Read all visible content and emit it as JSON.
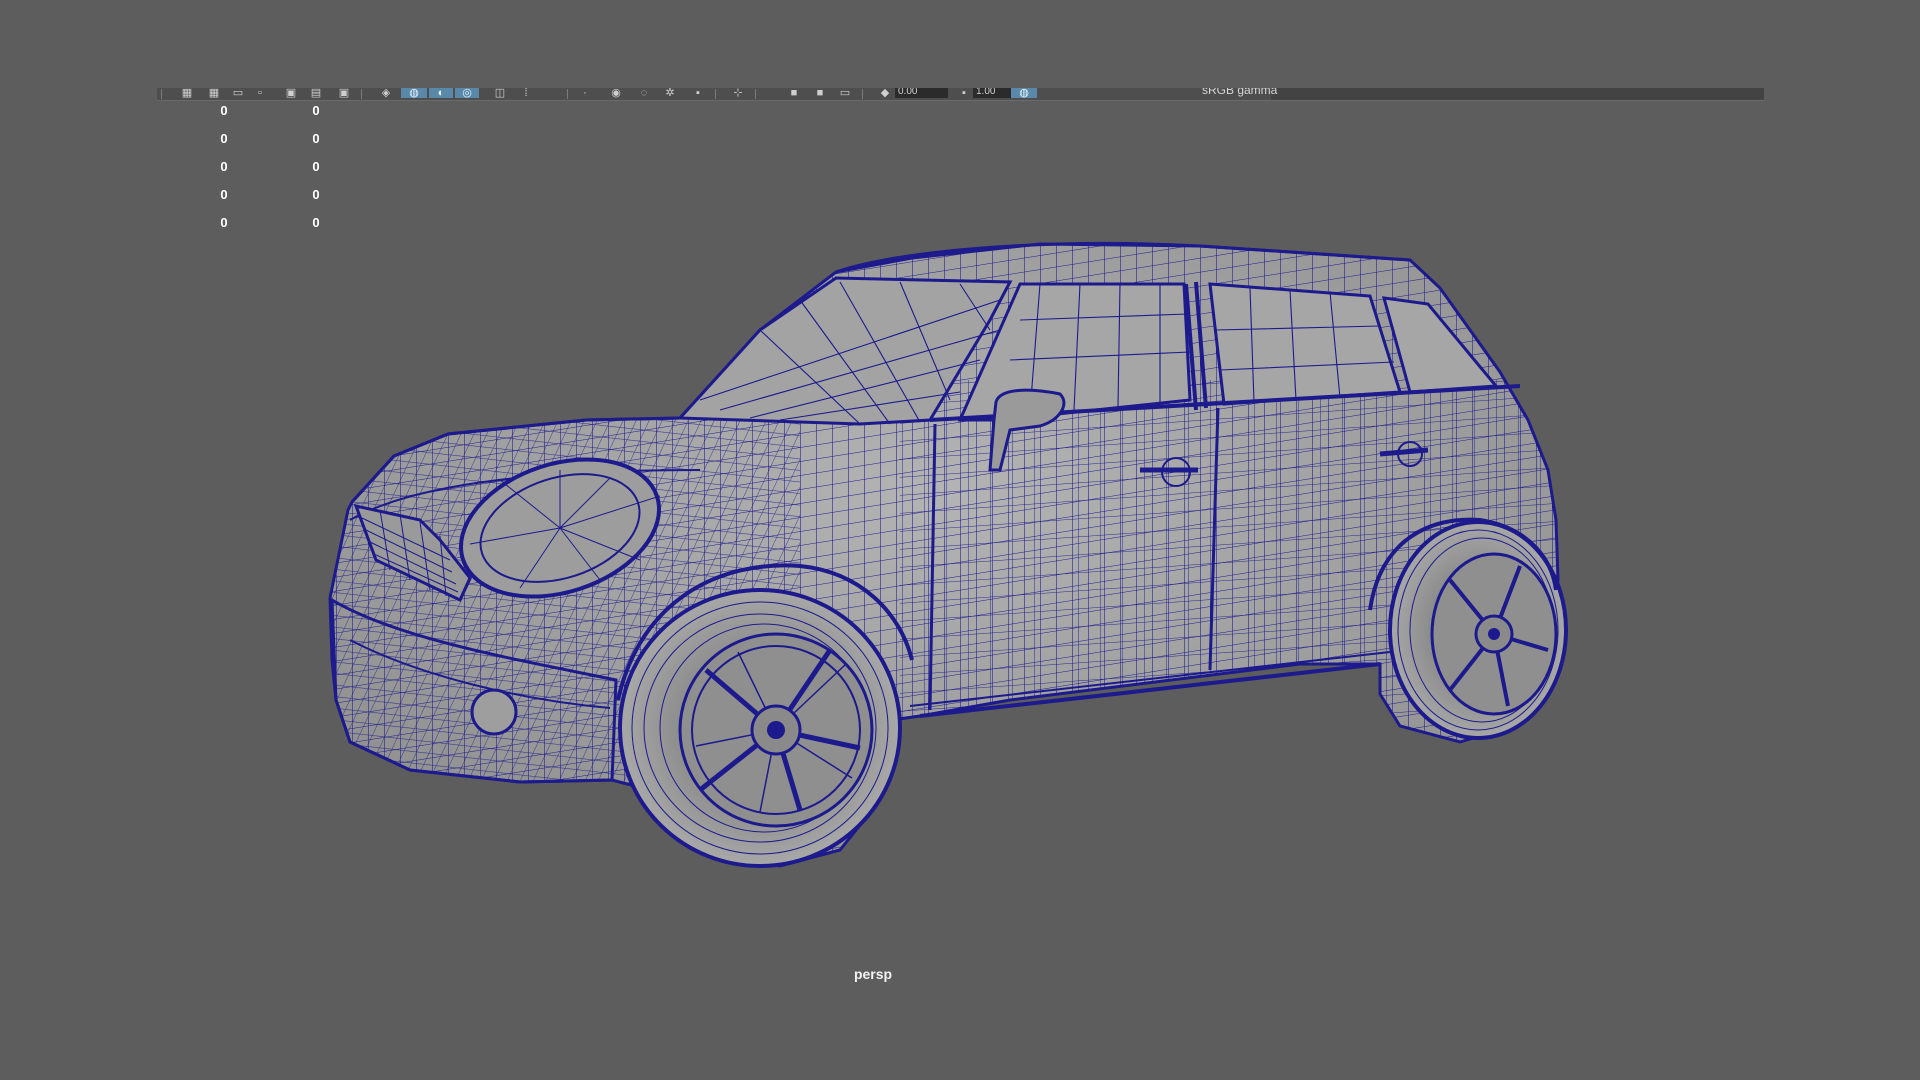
{
  "viewport": {
    "background": "#5d5d5d",
    "wireframe_color": "#1c1a8c",
    "shaded_color": "#9e9e9e",
    "camera_name": "persp",
    "model": "car (four-door hatchback) in wireframe-on-shaded mode"
  },
  "toolbar": {
    "icons": [
      {
        "icon": "select-camera-icon"
      },
      {
        "icon": "grid-icon"
      },
      {
        "icon": "film-gate-icon"
      },
      {
        "icon": "resolution-gate-icon"
      },
      {
        "icon": "gate-mask-icon"
      },
      {
        "icon": "field-chart-icon"
      },
      {
        "icon": "safe-action-icon"
      },
      {
        "icon": "safe-title-icon"
      },
      {
        "icon": "wireframe-icon"
      },
      {
        "icon": "smooth-shade-icon",
        "active": true
      },
      {
        "icon": "default-material-icon",
        "active": true
      },
      {
        "icon": "wireframe-on-shaded-icon",
        "active": true
      },
      {
        "icon": "textured-icon"
      },
      {
        "icon": "lights-icon"
      },
      {
        "icon": "shadows-icon"
      },
      {
        "icon": "ambient-occlusion-icon"
      },
      {
        "icon": "isolate-select-icon"
      },
      {
        "icon": "xray-icon"
      },
      {
        "icon": "xray-joints-icon"
      },
      {
        "icon": "xray-components-icon"
      },
      {
        "icon": "exposure-icon"
      },
      {
        "icon": "gamma-icon"
      },
      {
        "icon": "color-management-icon",
        "active": true
      }
    ],
    "exposure_value": "0.00",
    "gamma_value": "1.00",
    "view_transform_label": "sRGB gamma"
  },
  "hud": {
    "rows": [
      [
        "0",
        "0"
      ],
      [
        "0",
        "0"
      ],
      [
        "0",
        "0"
      ],
      [
        "0",
        "0"
      ],
      [
        "0",
        "0"
      ]
    ]
  }
}
